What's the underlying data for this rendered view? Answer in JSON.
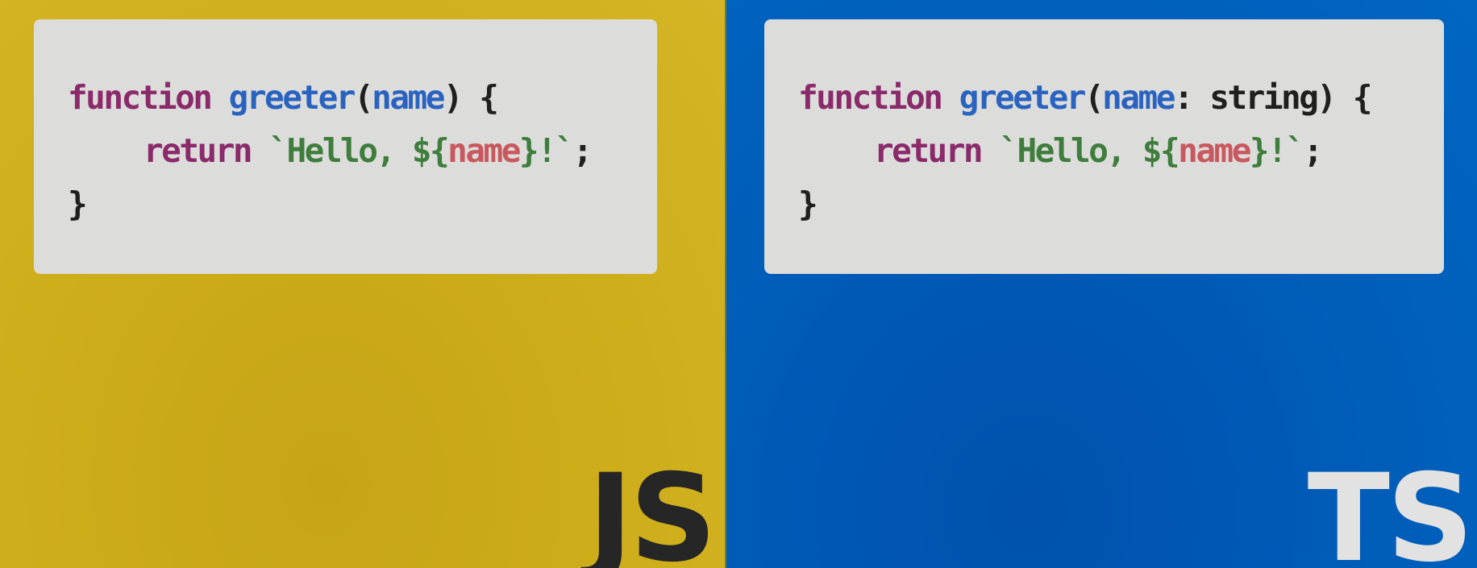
{
  "colors": {
    "js_background": "#d2b020",
    "ts_background": "#005cb8",
    "code_card": "#dcdddb",
    "keyword": "#8b2a6b",
    "function_name": "#2a63bf",
    "string": "#3f7d3c",
    "variable": "#c9585e",
    "js_label": "#262626",
    "ts_label": "#e2e2e2"
  },
  "js": {
    "label": "JS",
    "line1": {
      "keyword": "function",
      "fn_name": "greeter",
      "open_paren": "(",
      "param": "name",
      "close": ") {"
    },
    "line2": {
      "keyword": "return",
      "str_start": "`Hello, ${",
      "var": "name",
      "str_end": "}!`",
      "semicolon": ";"
    },
    "line3": {
      "close_brace": "}"
    }
  },
  "ts": {
    "label": "TS",
    "line1": {
      "keyword": "function",
      "fn_name": "greeter",
      "open_paren": "(",
      "param": "name",
      "colon": ": ",
      "type": "string",
      "close": ") {"
    },
    "line2": {
      "keyword": "return",
      "str_start": "`Hello, ${",
      "var": "name",
      "str_end": "}!`",
      "semicolon": ";"
    },
    "line3": {
      "close_brace": "}"
    }
  }
}
